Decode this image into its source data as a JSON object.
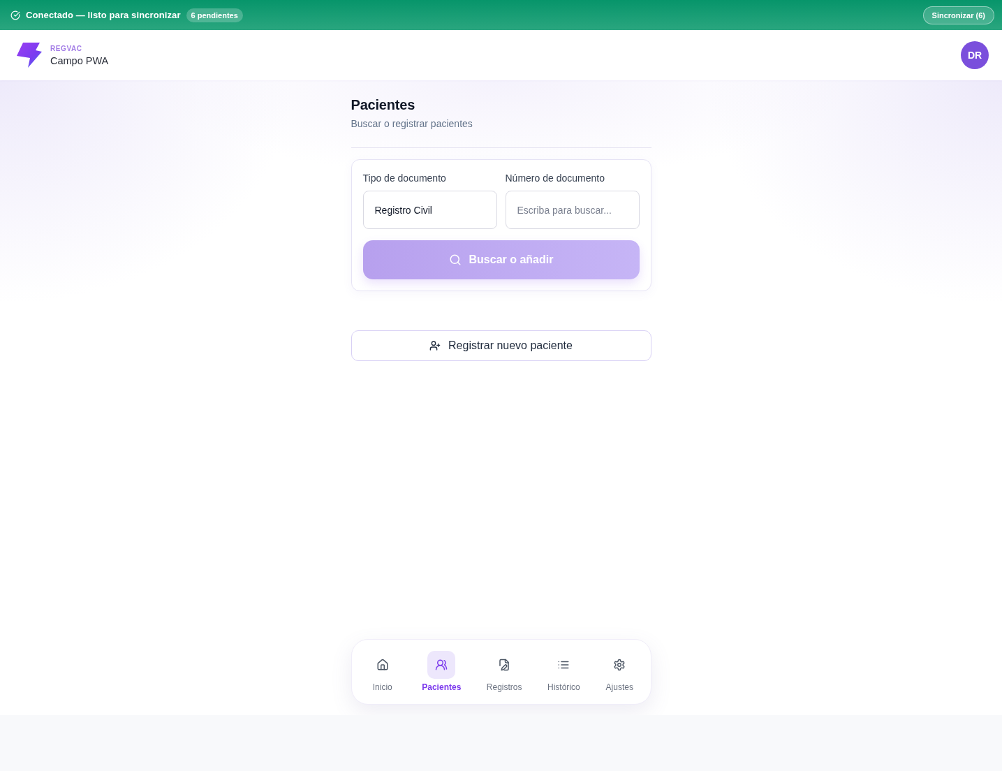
{
  "status_bar": {
    "connected": true,
    "message": "Conectado — listo para sincronizar",
    "pending_badge": "6 pendientes",
    "sync_button": "Sincronizar (6)"
  },
  "header": {
    "brand": "REGVAC",
    "app_name": "Campo PWA",
    "avatar": "DR"
  },
  "page": {
    "title": "Pacientes",
    "subtitle": "Buscar o registrar pacientes"
  },
  "search_form": {
    "fields": [
      {
        "kind": "select",
        "label": "Tipo de documento",
        "value": "Registro Civil"
      },
      {
        "kind": "text",
        "label": "Número de documento",
        "placeholder": "Escriba para buscar..."
      }
    ],
    "submit": {
      "label": "Buscar o añadir",
      "disabled": true
    }
  },
  "register_button": {
    "label": "Registrar nuevo paciente"
  },
  "bottom_nav": [
    {
      "label": "Inicio",
      "selected": false
    },
    {
      "label": "Pacientes",
      "selected": true
    },
    {
      "label": "Registros",
      "selected": false
    },
    {
      "label": "Histórico",
      "selected": false
    },
    {
      "label": "Ajustes",
      "selected": false
    }
  ]
}
